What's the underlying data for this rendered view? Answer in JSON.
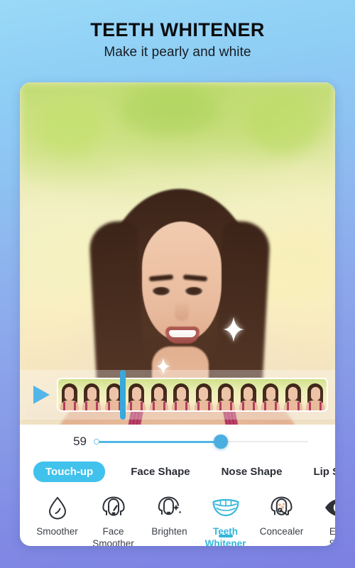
{
  "header": {
    "title": "TEETH WHITENER",
    "subtitle": "Make it pearly and white"
  },
  "colors": {
    "accent_blue": "#41c2ec",
    "accent_teal": "#35b7d9",
    "slider_blue": "#4aaee0",
    "playhead_blue": "#39a8dd",
    "bg_top": "#9ad9f7",
    "bg_bottom": "#7c81e2",
    "card_bg": "#ffffff"
  },
  "photo": {
    "alt": "Smiling young woman with long brown hair and pink strap top outdoors",
    "sparkles": [
      "sparkle-large",
      "sparkle-small"
    ]
  },
  "timeline": {
    "play_icon": "play-icon",
    "frame_count": 12,
    "playhead_position_pct": 33
  },
  "slider": {
    "value": "59",
    "fill_pct": 59,
    "min": 0,
    "max": 100
  },
  "tabs": [
    {
      "label": "Touch-up",
      "active": true
    },
    {
      "label": "Face Shape",
      "active": false
    },
    {
      "label": "Nose Shape",
      "active": false
    },
    {
      "label": "Lip Shape",
      "active": false
    }
  ],
  "tools": [
    {
      "label": "Smoother",
      "icon": "droplet-icon",
      "active": false
    },
    {
      "label": "Face\nSmoother",
      "icon": "face-brush-icon",
      "active": false
    },
    {
      "label": "Brighten",
      "icon": "face-sparkle-icon",
      "active": false
    },
    {
      "label": "Teeth\nWhitener",
      "icon": "smile-teeth-icon",
      "active": true
    },
    {
      "label": "Concealer",
      "icon": "face-blemish-icon",
      "active": false
    },
    {
      "label": "Eye\nSpa",
      "icon": "eye-icon",
      "active": false
    }
  ]
}
